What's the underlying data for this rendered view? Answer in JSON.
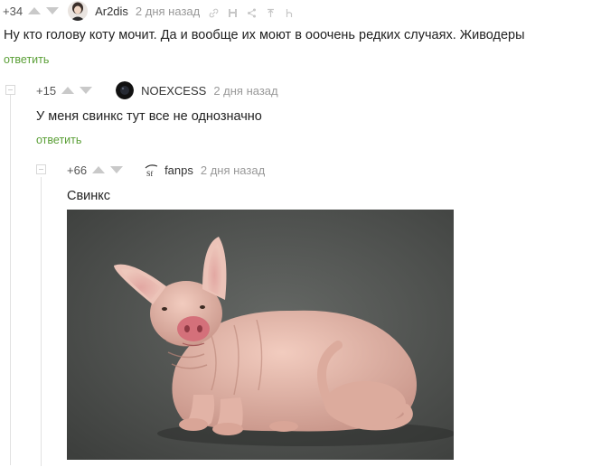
{
  "comments": [
    {
      "rating": "+34",
      "author": "Ar2dis",
      "time": "2 дня назад",
      "text": "Ну кто голову коту мочит. Да и вообще их моют в ооочень редких случаях. Живодеры",
      "reply": "ответить",
      "tools": [
        "link-icon",
        "save-icon",
        "share-icon",
        "pin-icon",
        "h-icon"
      ]
    },
    {
      "rating": "+15",
      "author": "NOEXCESS",
      "time": "2 дня назад",
      "text": "У меня свинкс тут все не однозначно",
      "reply": "ответить"
    },
    {
      "rating": "+66",
      "author": "fanps",
      "avatar_text": "Sf",
      "time": "2 дня назад",
      "text": "Свинкс"
    }
  ],
  "colors": {
    "reply_link": "#5a9f36",
    "arrows": "#c9c9c9",
    "photo_background": "#4f514f",
    "cat_skin": "#e6b8a8",
    "snout": "#d4707a"
  }
}
